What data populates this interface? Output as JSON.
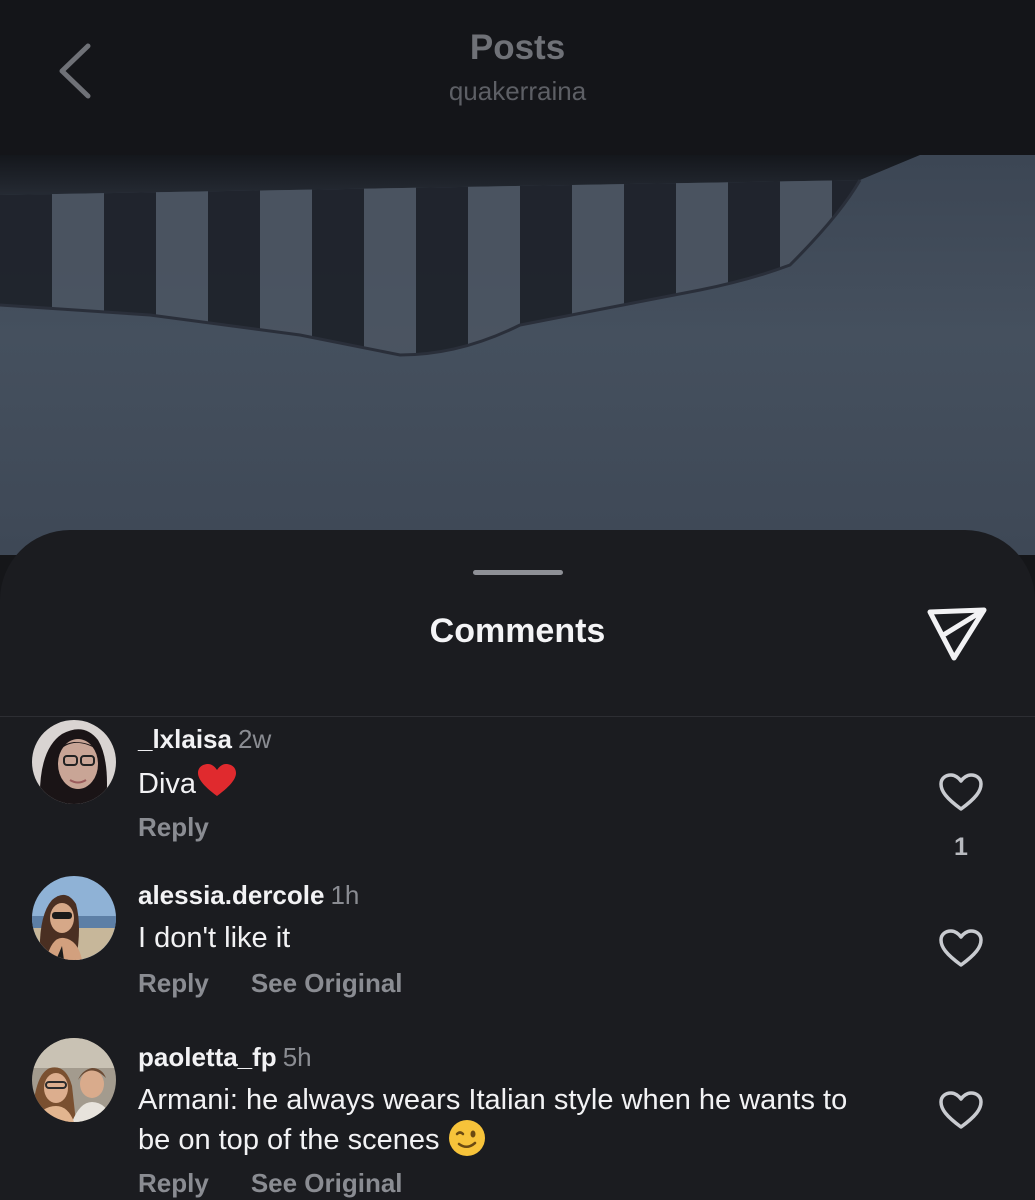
{
  "header": {
    "title": "Posts",
    "subtitle": "quakerraina"
  },
  "sheet": {
    "title": "Comments"
  },
  "comments": [
    {
      "username": "_lxlaisa",
      "time": "2w",
      "text": "Diva",
      "emoji": "red-heart",
      "reply_label": "Reply",
      "like_count": "1"
    },
    {
      "username": "alessia.dercole",
      "time": "1h",
      "text": "I don't like it",
      "reply_label": "Reply",
      "see_original_label": "See Original"
    },
    {
      "username": "paoletta_fp",
      "time": "5h",
      "text": "Armani: he always wears Italian style when he wants to be on top of the scenes",
      "emoji": "winking-face",
      "reply_label": "Reply",
      "see_original_label": "See Original"
    }
  ],
  "icons": {
    "back": "chevron-left-icon",
    "share": "paper-plane-icon",
    "like": "heart-outline-icon"
  },
  "colors": {
    "background": "#151619",
    "sheet": "#1b1c20",
    "text_primary": "#f2f2f4",
    "text_secondary": "#8a8c92",
    "image_sky": "#45505e"
  }
}
